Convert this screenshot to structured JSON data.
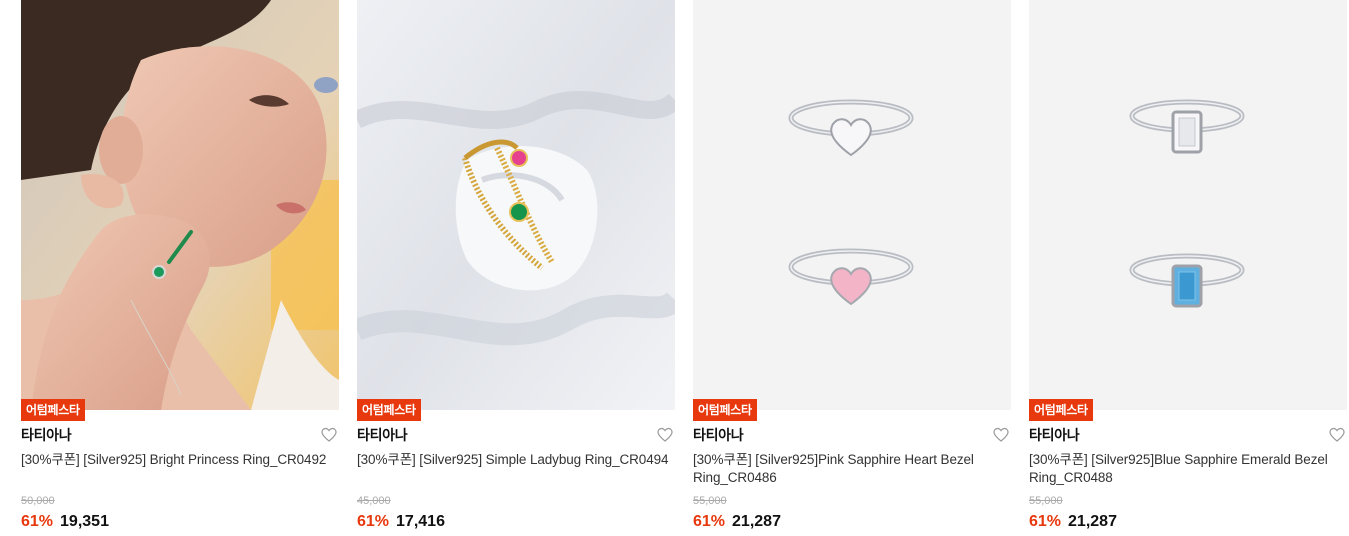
{
  "products": [
    {
      "badge": "어텀페스타",
      "brand": "타티아나",
      "name": "[30%쿠폰] [Silver925] Bright Princess Ring_CR0492",
      "original_price": "50,000",
      "discount": "61%",
      "price": "19,351"
    },
    {
      "badge": "어텀페스타",
      "brand": "타티아나",
      "name": "[30%쿠폰] [Silver925] Simple Ladybug Ring_CR0494",
      "original_price": "45,000",
      "discount": "61%",
      "price": "17,416"
    },
    {
      "badge": "어텀페스타",
      "brand": "타티아나",
      "name": "[30%쿠폰] [Silver925]Pink Sapphire Heart Bezel Ring_CR0486",
      "original_price": "55,000",
      "discount": "61%",
      "price": "21,287"
    },
    {
      "badge": "어텀페스타",
      "brand": "타티아나",
      "name": "[30%쿠폰] [Silver925]Blue Sapphire Emerald Bezel Ring_CR0488",
      "original_price": "55,000",
      "discount": "61%",
      "price": "21,287"
    }
  ],
  "icons": {
    "wishlist": "heart-outline-icon"
  },
  "colors": {
    "accent": "#e8380d",
    "image_bg": "#f3f3f3"
  }
}
